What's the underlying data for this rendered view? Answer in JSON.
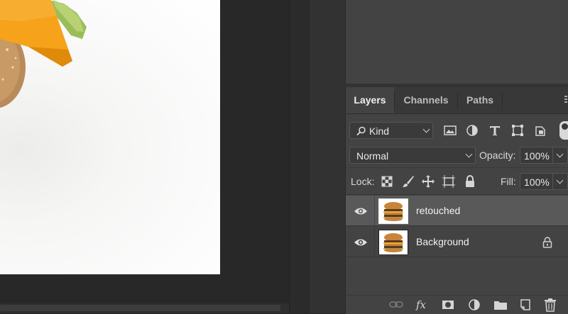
{
  "tabs": [
    {
      "label": "Layers",
      "active": true
    },
    {
      "label": "Channels",
      "active": false
    },
    {
      "label": "Paths",
      "active": false
    }
  ],
  "filter": {
    "label": "Kind"
  },
  "blend_mode": "Normal",
  "opacity": {
    "label": "Opacity:",
    "value": "100%"
  },
  "lock": {
    "label": "Lock:"
  },
  "fill": {
    "label": "Fill:",
    "value": "100%"
  },
  "layers": [
    {
      "name": "retouched",
      "visible": true,
      "selected": true,
      "locked": false
    },
    {
      "name": "Background",
      "visible": true,
      "selected": false,
      "locked": true
    }
  ],
  "colors": {
    "panel_bg": "#434343",
    "selected_row": "#595959",
    "canvas_bg": "#282828",
    "cheese": "#f6a21a"
  },
  "icons": [
    "search-icon",
    "image-filter-icon",
    "adjustment-filter-icon",
    "type-filter-icon",
    "shape-filter-icon",
    "smart-object-filter-icon",
    "filter-toggle-icon",
    "lock-transparent-icon",
    "lock-paint-icon",
    "lock-position-icon",
    "lock-artboard-icon",
    "lock-all-icon",
    "eye-icon",
    "lock-icon",
    "link-icon",
    "fx-icon",
    "mask-icon",
    "adjustment-layer-icon",
    "group-folder-icon",
    "new-layer-icon",
    "trash-icon"
  ]
}
